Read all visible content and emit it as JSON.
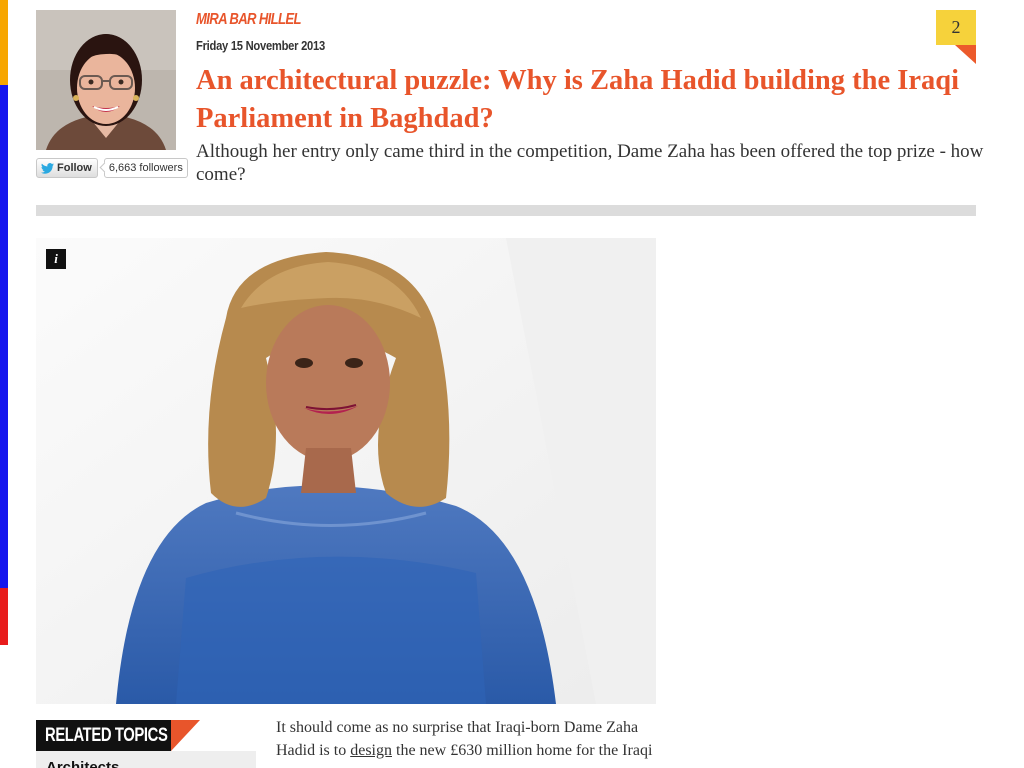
{
  "colors": {
    "accent": "#e8552b",
    "comment_badge": "#f6d23b",
    "strip_orange": "#f7a600",
    "strip_blue": "#1616ee",
    "strip_red": "#e81c1c"
  },
  "author": {
    "name": "MIRA BAR HILLEL",
    "photo_icon": "author-portrait",
    "twitter": {
      "follow_label": "Follow",
      "followers": "6,663 followers",
      "icon": "twitter-bird-icon"
    }
  },
  "article": {
    "date": "Friday 15 November 2013",
    "headline": "An architectural puzzle: Why is Zaha Hadid building the Iraqi Parliament in Baghdad?",
    "standfirst": "Although her entry only came third in the competition, Dame Zaha has been offered the top prize - how come?",
    "comment_count": "2",
    "image_info_label": "i",
    "body": {
      "text_before_link": "It should come as no surprise that Iraqi-born Dame Zaha Hadid is to ",
      "link_text": "design",
      "text_after_link": " the new £630 million home for the Iraqi"
    }
  },
  "related_topics": {
    "title": "RELATED TOPICS",
    "items": [
      "Architects"
    ]
  }
}
